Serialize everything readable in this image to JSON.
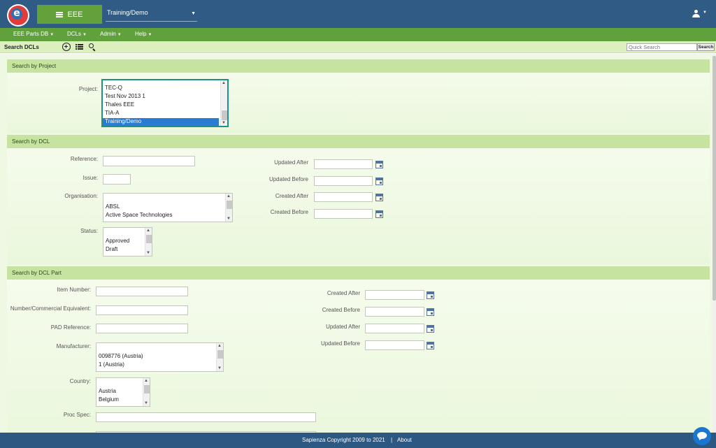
{
  "header": {
    "logo_letter": "e",
    "app_button_label": "EEE",
    "project_select_value": "Training/Demo"
  },
  "menu": {
    "items": [
      {
        "label": "EEE Parts DB"
      },
      {
        "label": "DCLs"
      },
      {
        "label": "Admin"
      },
      {
        "label": "Help"
      }
    ]
  },
  "toolbar": {
    "title": "Search DCLs",
    "quick_search_placeholder": "Quick Search",
    "search_button_label": "Search"
  },
  "search_by_project": {
    "header": "Search by Project",
    "project_label": "Project:",
    "project_options": [
      "TEC-Q",
      "Test Nov 2013 1",
      "Thales EEE",
      "TIA-A",
      "Training/Demo"
    ],
    "selected_option": "Training/Demo"
  },
  "search_by_dcl": {
    "header": "Search by DCL",
    "reference_label": "Reference:",
    "issue_label": "Issue:",
    "organisation_label": "Organisation:",
    "organisation_options": [
      "ABSL",
      "Active Space Technologies"
    ],
    "status_label": "Status:",
    "status_options": [
      "Approved",
      "Draft"
    ],
    "updated_after_label": "Updated After",
    "updated_before_label": "Updated Before",
    "created_after_label": "Created After",
    "created_before_label": "Created Before"
  },
  "search_by_dcl_part": {
    "header": "Search by DCL Part",
    "item_number_label": "Item Number:",
    "number_commercial_label": "Number/Commercial Equivalent:",
    "pad_reference_label": "PAD Reference:",
    "manufacturer_label": "Manufacturer:",
    "manufacturer_options": [
      "0098776 (Austria)",
      "1 (Austria)"
    ],
    "country_label": "Country:",
    "country_options": [
      "Austria",
      "Belgium"
    ],
    "proc_spec_label": "Proc Spec:",
    "created_after_label": "Created After",
    "created_before_label": "Created Before",
    "updated_after_label": "Updated After",
    "updated_before_label": "Updated Before"
  },
  "footer": {
    "copyright": "Sapienza Copyright 2009 to 2021",
    "separator": "|",
    "about_link": "About"
  }
}
